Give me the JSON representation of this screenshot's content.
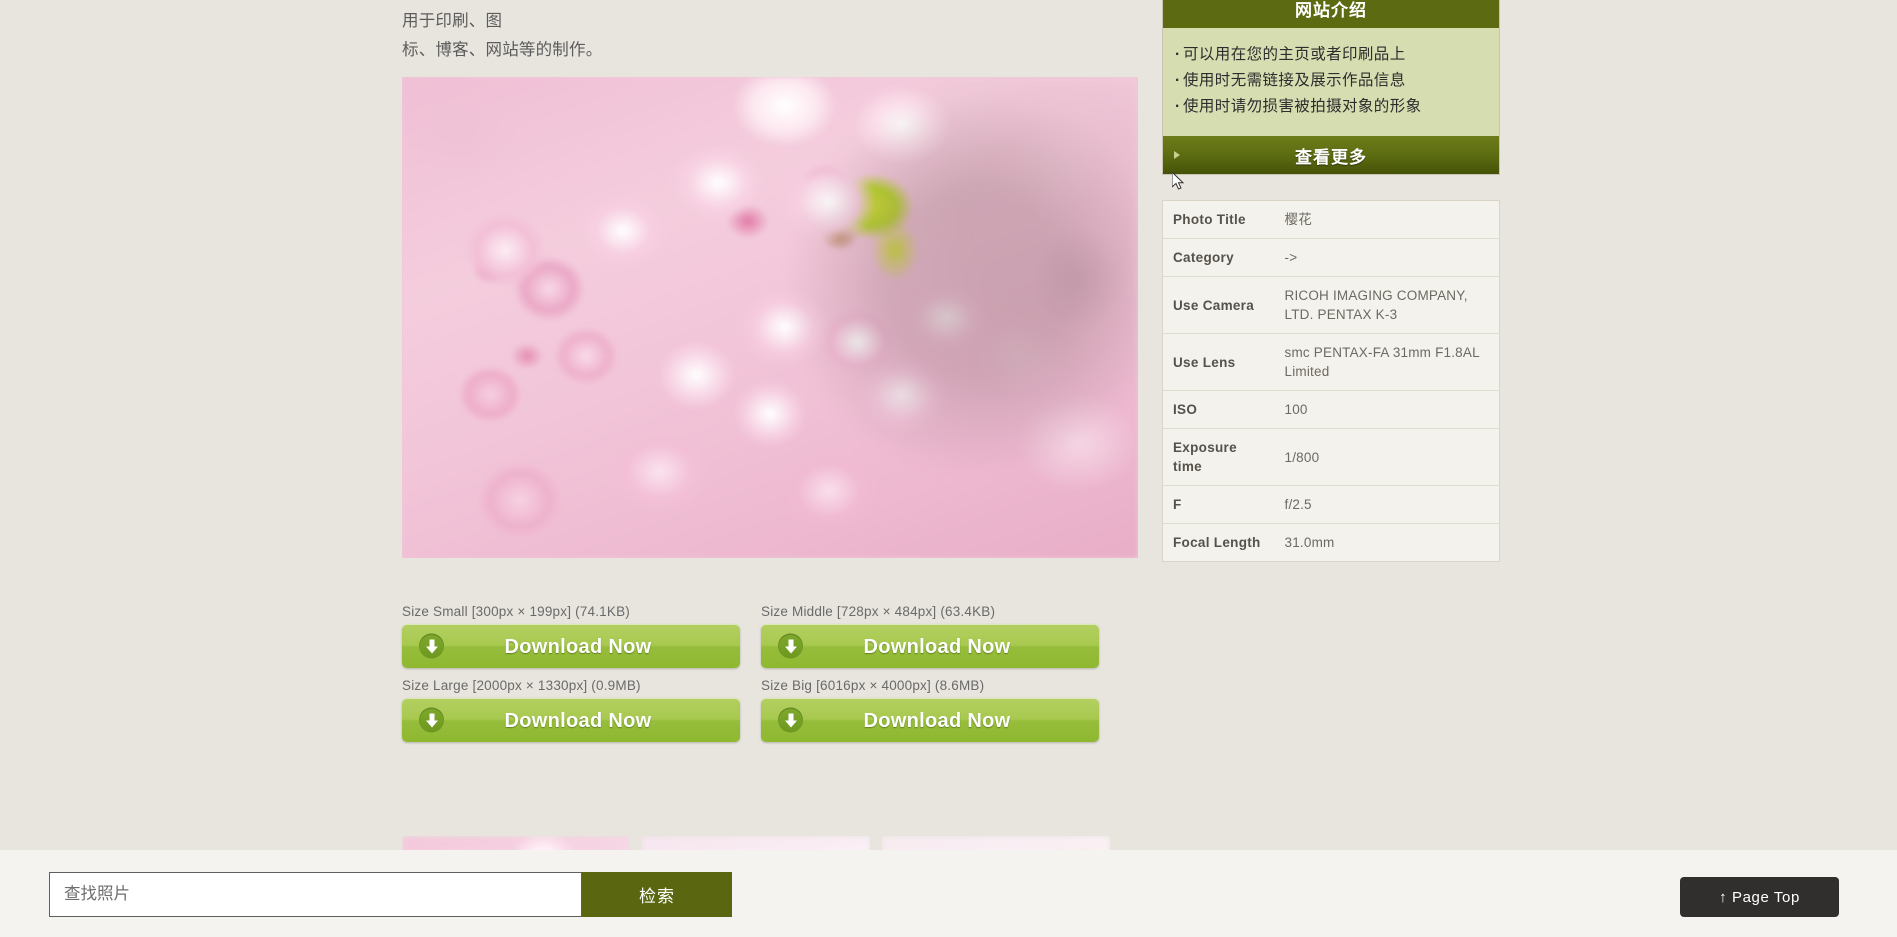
{
  "intro_paragraph": {
    "line1": "可以免费下载。在使用时，您无需标明出处、进行用户注册或报告使用情况。本网站的素材可以广泛用于印刷、图",
    "line2": "标、博客、网站等的制作。"
  },
  "sidebar": {
    "intro_box": {
      "title": "网站介绍",
      "items": [
        "可以用在您的主页或者印刷品上",
        "使用时无需链接及展示作品信息",
        "使用时请勿损害被拍摄对象的形象"
      ],
      "more_label": "查看更多",
      "caret_icon": "triangle-right-icon"
    },
    "meta_table": {
      "rows": [
        {
          "label": "Photo Title",
          "value": "樱花"
        },
        {
          "label": "Category",
          "value": "->"
        },
        {
          "label": "Use Camera",
          "value": "RICOH IMAGING COMPANY, LTD. PENTAX K-3"
        },
        {
          "label": "Use Lens",
          "value": "smc PENTAX-FA 31mm F1.8AL Limited"
        },
        {
          "label": "ISO",
          "value": "100"
        },
        {
          "label": "Exposure time",
          "value": "1/800"
        },
        {
          "label": "F",
          "value": "f/2.5"
        },
        {
          "label": "Focal Length",
          "value": "31.0mm"
        }
      ]
    }
  },
  "main_photo": {
    "alt": "cherry-blossom-photo"
  },
  "downloads": [
    {
      "size_label": "Size Small [300px × 199px] (74.1KB)",
      "button_label": "Download Now",
      "icon": "download-arrow-icon"
    },
    {
      "size_label": "Size Middle [728px × 484px] (63.4KB)",
      "button_label": "Download Now",
      "icon": "download-arrow-icon"
    },
    {
      "size_label": "Size Large [2000px × 1330px] (0.9MB)",
      "button_label": "Download Now",
      "icon": "download-arrow-icon"
    },
    {
      "size_label": "Size Big [6016px × 4000px] (8.6MB)",
      "button_label": "Download Now",
      "icon": "download-arrow-icon"
    }
  ],
  "thumbnails": [
    {
      "alt": "cherry-blossom-thumbnail-1"
    },
    {
      "alt": "cherry-blossom-thumbnail-2"
    },
    {
      "alt": "cherry-blossom-thumbnail-3"
    }
  ],
  "search_bar": {
    "input_value": "",
    "placeholder": "查找照片",
    "search_button_label": "检索",
    "page_top_label": "↑ Page Top"
  },
  "colors": {
    "page_background": "#e8e5de",
    "accent_olive": "#5c6b12",
    "accent_olive_dark": "#455208",
    "intro_box_body": "#d6ddb1",
    "download_green": "#a8c94f",
    "search_button": "#5a6710",
    "page_top_button": "#302f2d",
    "meta_table_bg": "#f4f2ec",
    "search_bar_bg": "#f5f3f0"
  }
}
